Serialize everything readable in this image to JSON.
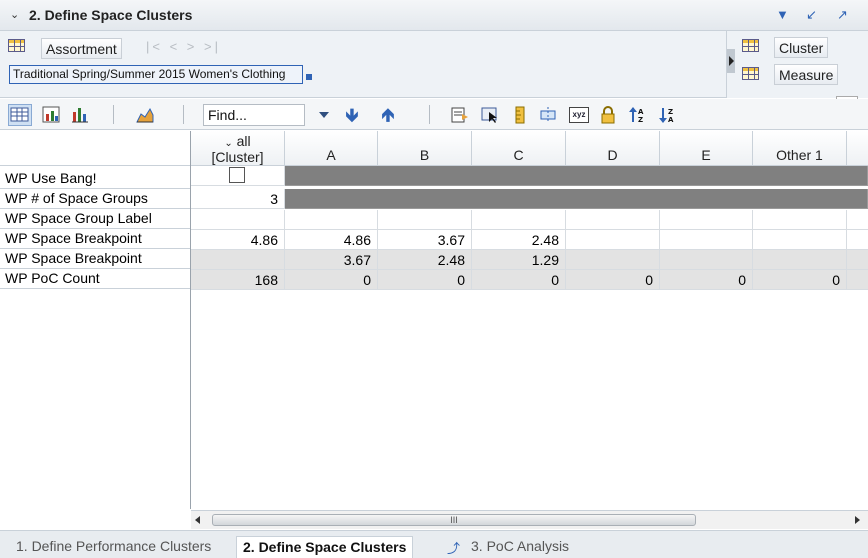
{
  "window": {
    "title": "2. Define Space Clusters"
  },
  "header": {
    "assortment_label": "Assortment",
    "nav_glyphs": "|< < > >|",
    "assortment_value": "Traditional Spring/Summer 2015 Women's Clothing",
    "cluster_label": "Cluster",
    "measure_label": "Measure"
  },
  "toolbar": {
    "find_placeholder": "Find..."
  },
  "table": {
    "corner_top": "all",
    "corner_bottom": "[Cluster]",
    "columns": [
      "A",
      "B",
      "C",
      "D",
      "E",
      "Other 1"
    ],
    "rows": [
      {
        "label": "WP Use Bang!",
        "all": "",
        "values": [
          "",
          "",
          "",
          "",
          "",
          ""
        ]
      },
      {
        "label": "WP # of Space Groups",
        "all": "3",
        "values": [
          "",
          "",
          "",
          "",
          "",
          ""
        ]
      },
      {
        "label": "WP Space Group Label",
        "all": "",
        "values": [
          "",
          "",
          "",
          "",
          "",
          ""
        ]
      },
      {
        "label": "WP Space Breakpoint",
        "all": "4.86",
        "values": [
          "4.86",
          "3.67",
          "2.48",
          "",
          "",
          ""
        ]
      },
      {
        "label": "WP Space Breakpoint",
        "all": "",
        "values": [
          "3.67",
          "2.48",
          "1.29",
          "",
          "",
          ""
        ]
      },
      {
        "label": "WP PoC Count",
        "all": "168",
        "values": [
          "0",
          "0",
          "0",
          "0",
          "0",
          "0"
        ]
      }
    ]
  },
  "scrollbar": {
    "thumb_grip": "III"
  },
  "tabs": [
    {
      "label": "1. Define Performance Clusters"
    },
    {
      "label": "2. Define Space Clusters"
    },
    {
      "label": "3. PoC Analysis"
    }
  ]
}
